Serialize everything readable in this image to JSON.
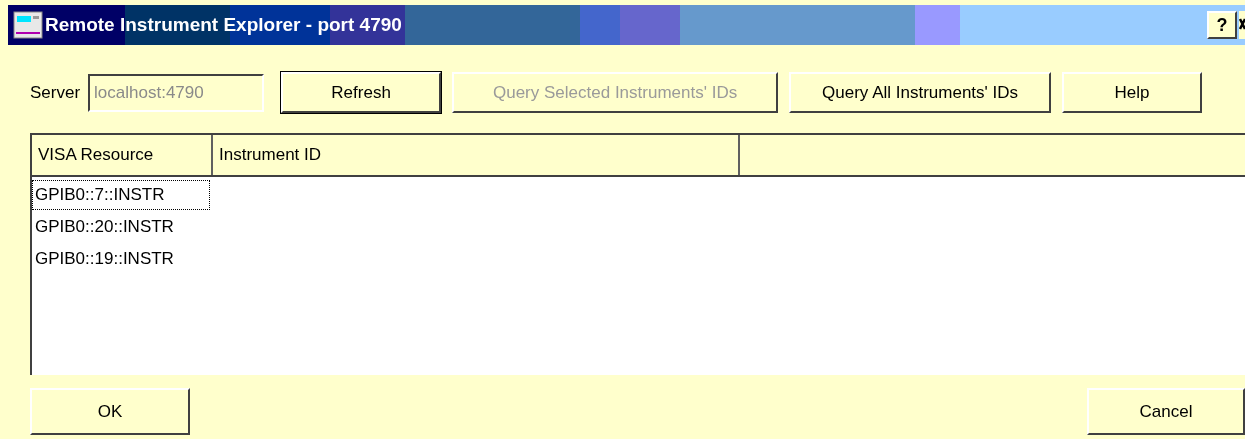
{
  "window": {
    "title": "Remote Instrument Explorer - port 4790",
    "help_button": "?"
  },
  "server": {
    "label": "Server",
    "value": "localhost:4790",
    "disabled": true
  },
  "toolbar_buttons": [
    {
      "label": "Refresh",
      "disabled": false,
      "kind": "default"
    },
    {
      "label": "Query Selected Instruments' IDs",
      "disabled": true,
      "kind": "normal"
    },
    {
      "label": "Query All Instruments' IDs",
      "disabled": false,
      "kind": "normal"
    },
    {
      "label": "Help",
      "disabled": false,
      "kind": "normal"
    }
  ],
  "table": {
    "columns": [
      "VISA Resource",
      "Instrument ID"
    ],
    "rows": [
      {
        "resource": "GPIB0::7::INSTR",
        "focused": true
      },
      {
        "resource": "GPIB0::20::INSTR",
        "focused": false
      },
      {
        "resource": "GPIB0::19::INSTR",
        "focused": false
      }
    ]
  },
  "buttons": [
    "OK",
    "Cancel"
  ]
}
